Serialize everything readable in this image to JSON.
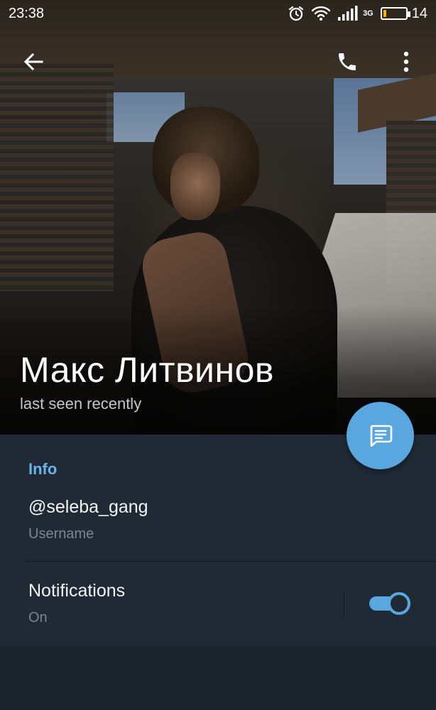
{
  "status_bar": {
    "time": "23:38",
    "network_type": "3G",
    "battery_level": "14",
    "battery_fraction": 0.14,
    "icons": [
      "alarm-icon",
      "wifi-icon",
      "signal-icon",
      "battery-icon"
    ]
  },
  "app_bar": {
    "back_icon": "arrow-left-icon",
    "call_icon": "phone-icon",
    "more_icon": "more-vertical-icon"
  },
  "profile": {
    "name": "Макс Литвинов",
    "status": "last seen recently"
  },
  "fab": {
    "icon": "message-icon",
    "color": "#5aa7e0"
  },
  "info": {
    "section_title": "Info",
    "username": {
      "value": "@seleba_gang",
      "label": "Username"
    },
    "notifications": {
      "title": "Notifications",
      "value": "On",
      "enabled": true
    }
  },
  "colors": {
    "accent": "#5aa7e0",
    "section_title": "#69b2ec",
    "panel_bg": "#202a35",
    "screen_bg": "#1c242e"
  }
}
